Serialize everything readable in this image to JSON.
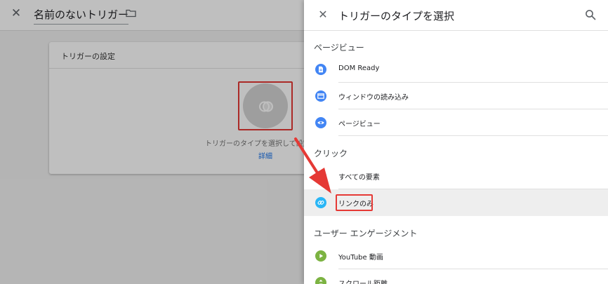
{
  "editor": {
    "title": "名前のないトリガー",
    "card": {
      "title": "トリガーの設定",
      "hint": "トリガーのタイプを選択して設定",
      "link": "詳細"
    }
  },
  "panel": {
    "title": "トリガーのタイプを選択",
    "sections": [
      {
        "header": "ページビュー",
        "items": [
          {
            "label": "DOM Ready",
            "icon": "document-icon",
            "color": "#4285f4"
          },
          {
            "label": "ウィンドウの読み込み",
            "icon": "window-icon",
            "color": "#4285f4"
          },
          {
            "label": "ページビュー",
            "icon": "eye-icon",
            "color": "#4285f4"
          }
        ]
      },
      {
        "header": "クリック",
        "items": [
          {
            "label": "すべての要素",
            "icon": "cursor-icon",
            "color": "#29b6f6"
          },
          {
            "label": "リンクのみ",
            "icon": "link-icon",
            "color": "#29b6f6",
            "selected": true
          }
        ]
      },
      {
        "header": "ユーザー エンゲージメント",
        "items": [
          {
            "label": "YouTube 動画",
            "icon": "play-icon",
            "color": "#7cb342"
          },
          {
            "label": "スクロール距離",
            "icon": "scroll-icon",
            "color": "#7cb342"
          }
        ]
      }
    ]
  },
  "colors": {
    "accent": "#1a73e8",
    "highlight": "#e53935"
  }
}
